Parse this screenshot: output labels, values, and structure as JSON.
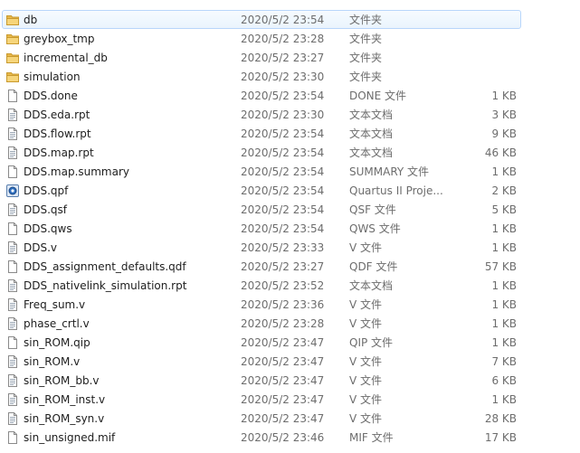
{
  "files": [
    {
      "name": "db",
      "date": "2020/5/2 23:54",
      "type": "文件夹",
      "size": "",
      "icon": "folder-icon"
    },
    {
      "name": "greybox_tmp",
      "date": "2020/5/2 23:28",
      "type": "文件夹",
      "size": "",
      "icon": "folder-icon"
    },
    {
      "name": "incremental_db",
      "date": "2020/5/2 23:27",
      "type": "文件夹",
      "size": "",
      "icon": "folder-icon"
    },
    {
      "name": "simulation",
      "date": "2020/5/2 23:30",
      "type": "文件夹",
      "size": "",
      "icon": "folder-icon"
    },
    {
      "name": "DDS.done",
      "date": "2020/5/2 23:54",
      "type": "DONE 文件",
      "size": "1 KB",
      "icon": "blank-file-icon"
    },
    {
      "name": "DDS.eda.rpt",
      "date": "2020/5/2 23:30",
      "type": "文本文档",
      "size": "3 KB",
      "icon": "text-file-icon"
    },
    {
      "name": "DDS.flow.rpt",
      "date": "2020/5/2 23:54",
      "type": "文本文档",
      "size": "9 KB",
      "icon": "text-file-icon"
    },
    {
      "name": "DDS.map.rpt",
      "date": "2020/5/2 23:54",
      "type": "文本文档",
      "size": "46 KB",
      "icon": "text-file-icon"
    },
    {
      "name": "DDS.map.summary",
      "date": "2020/5/2 23:54",
      "type": "SUMMARY 文件",
      "size": "1 KB",
      "icon": "blank-file-icon"
    },
    {
      "name": "DDS.qpf",
      "date": "2020/5/2 23:54",
      "type": "Quartus II Proje...",
      "size": "2 KB",
      "icon": "quartus-project-icon"
    },
    {
      "name": "DDS.qsf",
      "date": "2020/5/2 23:54",
      "type": "QSF 文件",
      "size": "5 KB",
      "icon": "text-file-icon"
    },
    {
      "name": "DDS.qws",
      "date": "2020/5/2 23:54",
      "type": "QWS 文件",
      "size": "1 KB",
      "icon": "blank-file-icon"
    },
    {
      "name": "DDS.v",
      "date": "2020/5/2 23:33",
      "type": "V 文件",
      "size": "1 KB",
      "icon": "text-file-icon"
    },
    {
      "name": "DDS_assignment_defaults.qdf",
      "date": "2020/5/2 23:27",
      "type": "QDF 文件",
      "size": "57 KB",
      "icon": "blank-file-icon"
    },
    {
      "name": "DDS_nativelink_simulation.rpt",
      "date": "2020/5/2 23:52",
      "type": "文本文档",
      "size": "1 KB",
      "icon": "text-file-icon"
    },
    {
      "name": "Freq_sum.v",
      "date": "2020/5/2 23:36",
      "type": "V 文件",
      "size": "1 KB",
      "icon": "text-file-icon"
    },
    {
      "name": "phase_crtl.v",
      "date": "2020/5/2 23:28",
      "type": "V 文件",
      "size": "1 KB",
      "icon": "text-file-icon"
    },
    {
      "name": "sin_ROM.qip",
      "date": "2020/5/2 23:47",
      "type": "QIP 文件",
      "size": "1 KB",
      "icon": "blank-file-icon"
    },
    {
      "name": "sin_ROM.v",
      "date": "2020/5/2 23:47",
      "type": "V 文件",
      "size": "7 KB",
      "icon": "text-file-icon"
    },
    {
      "name": "sin_ROM_bb.v",
      "date": "2020/5/2 23:47",
      "type": "V 文件",
      "size": "6 KB",
      "icon": "text-file-icon"
    },
    {
      "name": "sin_ROM_inst.v",
      "date": "2020/5/2 23:47",
      "type": "V 文件",
      "size": "1 KB",
      "icon": "text-file-icon"
    },
    {
      "name": "sin_ROM_syn.v",
      "date": "2020/5/2 23:47",
      "type": "V 文件",
      "size": "28 KB",
      "icon": "text-file-icon"
    },
    {
      "name": "sin_unsigned.mif",
      "date": "2020/5/2 23:46",
      "type": "MIF 文件",
      "size": "17 KB",
      "icon": "blank-file-icon"
    }
  ],
  "selected_index": 0,
  "colors": {
    "folder": "#e8b84a",
    "selection_bg": "#eaf4fd",
    "selection_border": "#b8d6fb",
    "secondary_text": "#6d6d6d"
  }
}
